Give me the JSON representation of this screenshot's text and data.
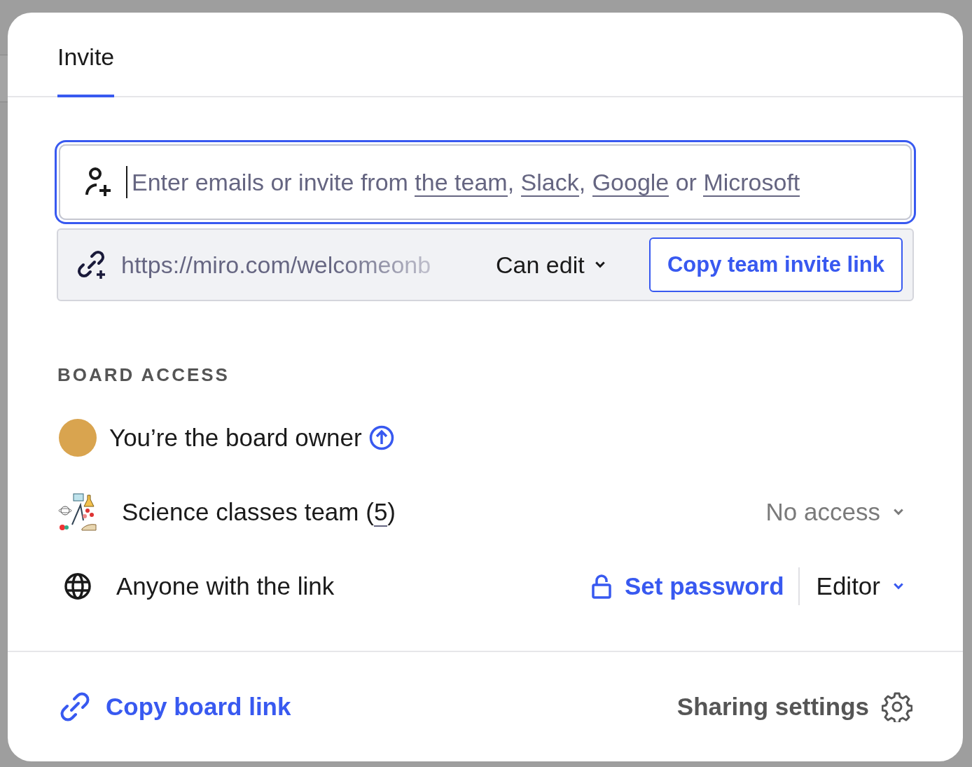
{
  "tabs": [
    {
      "label": "Invite",
      "selected": true
    }
  ],
  "invite_field": {
    "placeholder_parts": [
      {
        "kind": "text",
        "text": "Enter emails or invite from "
      },
      {
        "kind": "link",
        "text": "the team"
      },
      {
        "kind": "text",
        "text": ", "
      },
      {
        "kind": "link",
        "text": "Slack"
      },
      {
        "kind": "text",
        "text": ", "
      },
      {
        "kind": "link",
        "text": "Google"
      },
      {
        "kind": "text",
        "text": " or "
      },
      {
        "kind": "link",
        "text": "Microsoft"
      }
    ],
    "focused": true
  },
  "invite_link": {
    "value": "https://miro.com/welcomeonb",
    "permission": "Can edit",
    "button": "Copy team invite link"
  },
  "board_access": {
    "heading": "BOARD ACCESS",
    "rows": [
      {
        "kind": "owner",
        "label": "You’re the board owner"
      },
      {
        "kind": "team",
        "label_parts": [
          {
            "kind": "text",
            "text": "Science classes team ("
          },
          {
            "kind": "link",
            "text": "5"
          },
          {
            "kind": "text",
            "text": ")"
          }
        ],
        "access": "No access",
        "access_enabled": false
      },
      {
        "kind": "link",
        "label": "Anyone with the link",
        "password_action": "Set password",
        "access": "Editor",
        "access_enabled": true
      }
    ]
  },
  "footer": {
    "copy_link": "Copy board link",
    "settings": "Sharing settings"
  }
}
